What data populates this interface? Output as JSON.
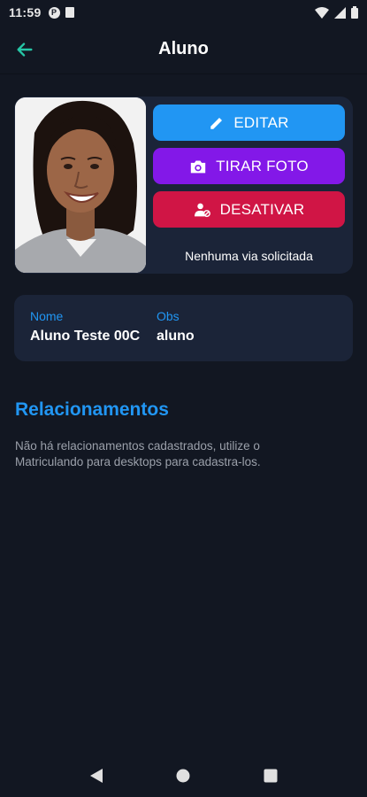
{
  "status_bar": {
    "time": "11:59",
    "notification_icons": [
      "p-icon",
      "sim-card-icon"
    ],
    "system_icons": [
      "wifi-icon",
      "signal-icon",
      "battery-icon"
    ]
  },
  "app_bar": {
    "title": "Aluno",
    "back_icon": "arrow-left-icon"
  },
  "profile": {
    "photo_icon": "student-photo",
    "actions": [
      {
        "label": "EDITAR",
        "icon": "pencil-icon",
        "color": "#2196f3"
      },
      {
        "label": "TIRAR FOTO",
        "icon": "camera-icon",
        "color": "#8318e8"
      },
      {
        "label": "DESATIVAR",
        "icon": "user-block-icon",
        "color": "#d01545"
      }
    ],
    "via_status": "Nenhuma via solicitada"
  },
  "info": {
    "name_label": "Nome",
    "name_value": "Aluno Teste 00C",
    "obs_label": "Obs",
    "obs_value": "aluno"
  },
  "relationships": {
    "title": "Relacionamentos",
    "message": "Não há relacionamentos cadastrados, utilize o Matriculando para desktops para cadastra-los."
  },
  "nav_bar": {
    "buttons": [
      "back-triangle-icon",
      "home-circle-icon",
      "recents-square-icon"
    ]
  },
  "colors": {
    "background": "#121722",
    "card": "#1b2438",
    "accent_blue": "#2196f3",
    "accent_green": "#26c6a6",
    "accent_purple": "#8318e8",
    "accent_red": "#d01545"
  }
}
